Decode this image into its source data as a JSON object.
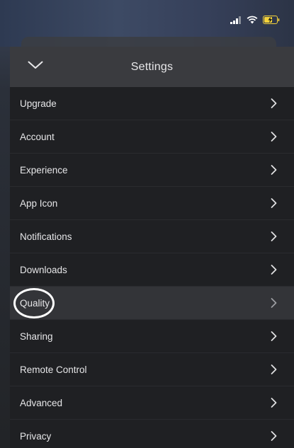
{
  "header": {
    "title": "Settings",
    "collapse_icon": "chevron-down-icon"
  },
  "status_bar": {
    "icons": [
      "cellular-signal-icon",
      "wifi-icon",
      "battery-charging-icon"
    ],
    "battery_color": "#f5d33b"
  },
  "settings": {
    "items": [
      {
        "label": "Upgrade"
      },
      {
        "label": "Account"
      },
      {
        "label": "Experience"
      },
      {
        "label": "App Icon"
      },
      {
        "label": "Notifications"
      },
      {
        "label": "Downloads"
      },
      {
        "label": "Quality",
        "highlighted": true
      },
      {
        "label": "Sharing"
      },
      {
        "label": "Remote Control"
      },
      {
        "label": "Advanced"
      },
      {
        "label": "Privacy"
      }
    ]
  },
  "colors": {
    "header_bg": "#3a3b3f",
    "list_bg": "#1f2023",
    "highlight_bg": "#333438",
    "text": "#e6e6e8"
  }
}
